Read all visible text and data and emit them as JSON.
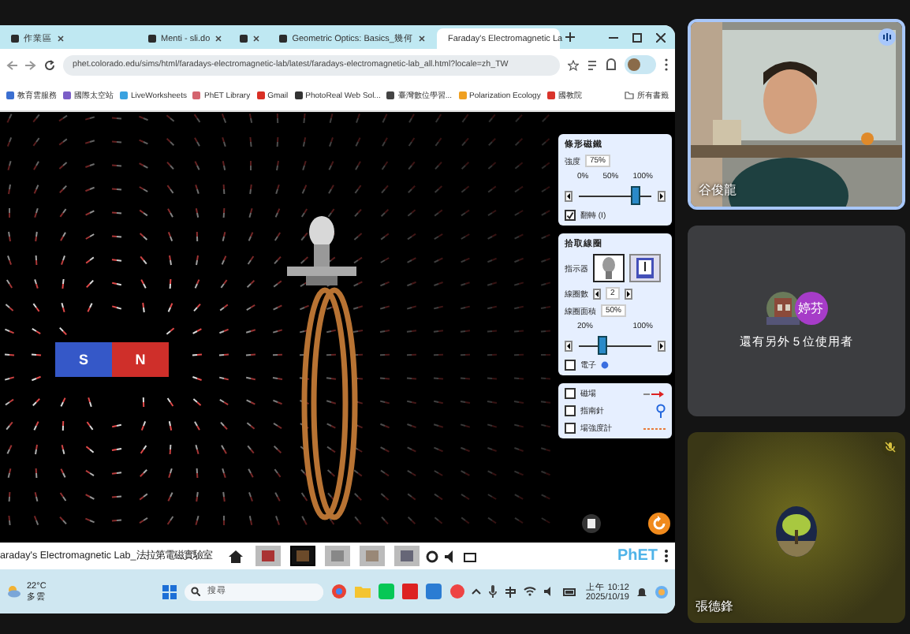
{
  "browser": {
    "tabs": [
      {
        "title": "作業區",
        "selected": false
      },
      {
        "title": "Menti - sli.do",
        "selected": false
      },
      {
        "selected": false
      },
      {
        "title": "Geometric Optics: Basics_幾何",
        "selected": false
      },
      {
        "title": "Faraday's Electromagnetic La",
        "selected": true
      }
    ],
    "address": "phet.colorado.edu/sims/html/faradays-electromagnetic-lab/latest/faradays-electromagnetic-lab_all.html?locale=zh_TW",
    "bookmarks": [
      "教育雲服務",
      "國際太空站",
      "LiveWorksheets",
      "PhET Library",
      "Gmail",
      "PhotoReal Web Sol...",
      "臺灣數位學習...",
      "Polarization Ecology",
      "國教院"
    ],
    "all_bookmarks": "所有書籤"
  },
  "simulation": {
    "magnet": {
      "south": "S",
      "north": "N"
    },
    "bar_magnet_panel": {
      "title": "條形磁鐵",
      "strength_label": "強度",
      "strength": "75%",
      "ticks": [
        "0%",
        "50%",
        "100%"
      ],
      "level": 0.75,
      "flip": {
        "label": "翻轉 (I)",
        "checked": true
      }
    },
    "pickup_coil_panel": {
      "title": "拾取線圈",
      "indicator_label": "指示器",
      "indicators": [
        {
          "kind": "bulb",
          "selected": true
        },
        {
          "kind": "voltmeter",
          "selected": false
        }
      ],
      "loops_label": "線圈數",
      "loops": "2",
      "area_label": "線圈面積",
      "area": "50%",
      "ticks": [
        "20%",
        "100%"
      ],
      "level": 0.3,
      "electrons": {
        "label": "電子",
        "checked": false
      }
    },
    "options": [
      {
        "kind": "field",
        "label": "磁場",
        "checked": false
      },
      {
        "kind": "compass",
        "label": "指南針",
        "checked": false
      },
      {
        "kind": "meter",
        "label": "場強度計",
        "checked": false
      }
    ],
    "title": "araday's Electromagnetic Lab_法拉第電磁實驗室",
    "screens": [
      {
        "selected": false
      },
      {
        "selected": true
      },
      {
        "selected": false
      },
      {
        "selected": false
      },
      {
        "selected": false
      }
    ],
    "logo": "PhET"
  },
  "taskbar": {
    "temperature": "22°C",
    "weather": "多雲",
    "search": {
      "placeholder": "搜尋"
    },
    "time": "上午 10:12",
    "date": "2025/10/19"
  },
  "participants": [
    {
      "kind": "video",
      "name": "谷俊龍",
      "speaking": true
    },
    {
      "kind": "group",
      "avatar": "婷芬",
      "text": "還有另外 5 位使用者"
    },
    {
      "kind": "audio",
      "name": "張德鋒",
      "muted": true
    }
  ]
}
